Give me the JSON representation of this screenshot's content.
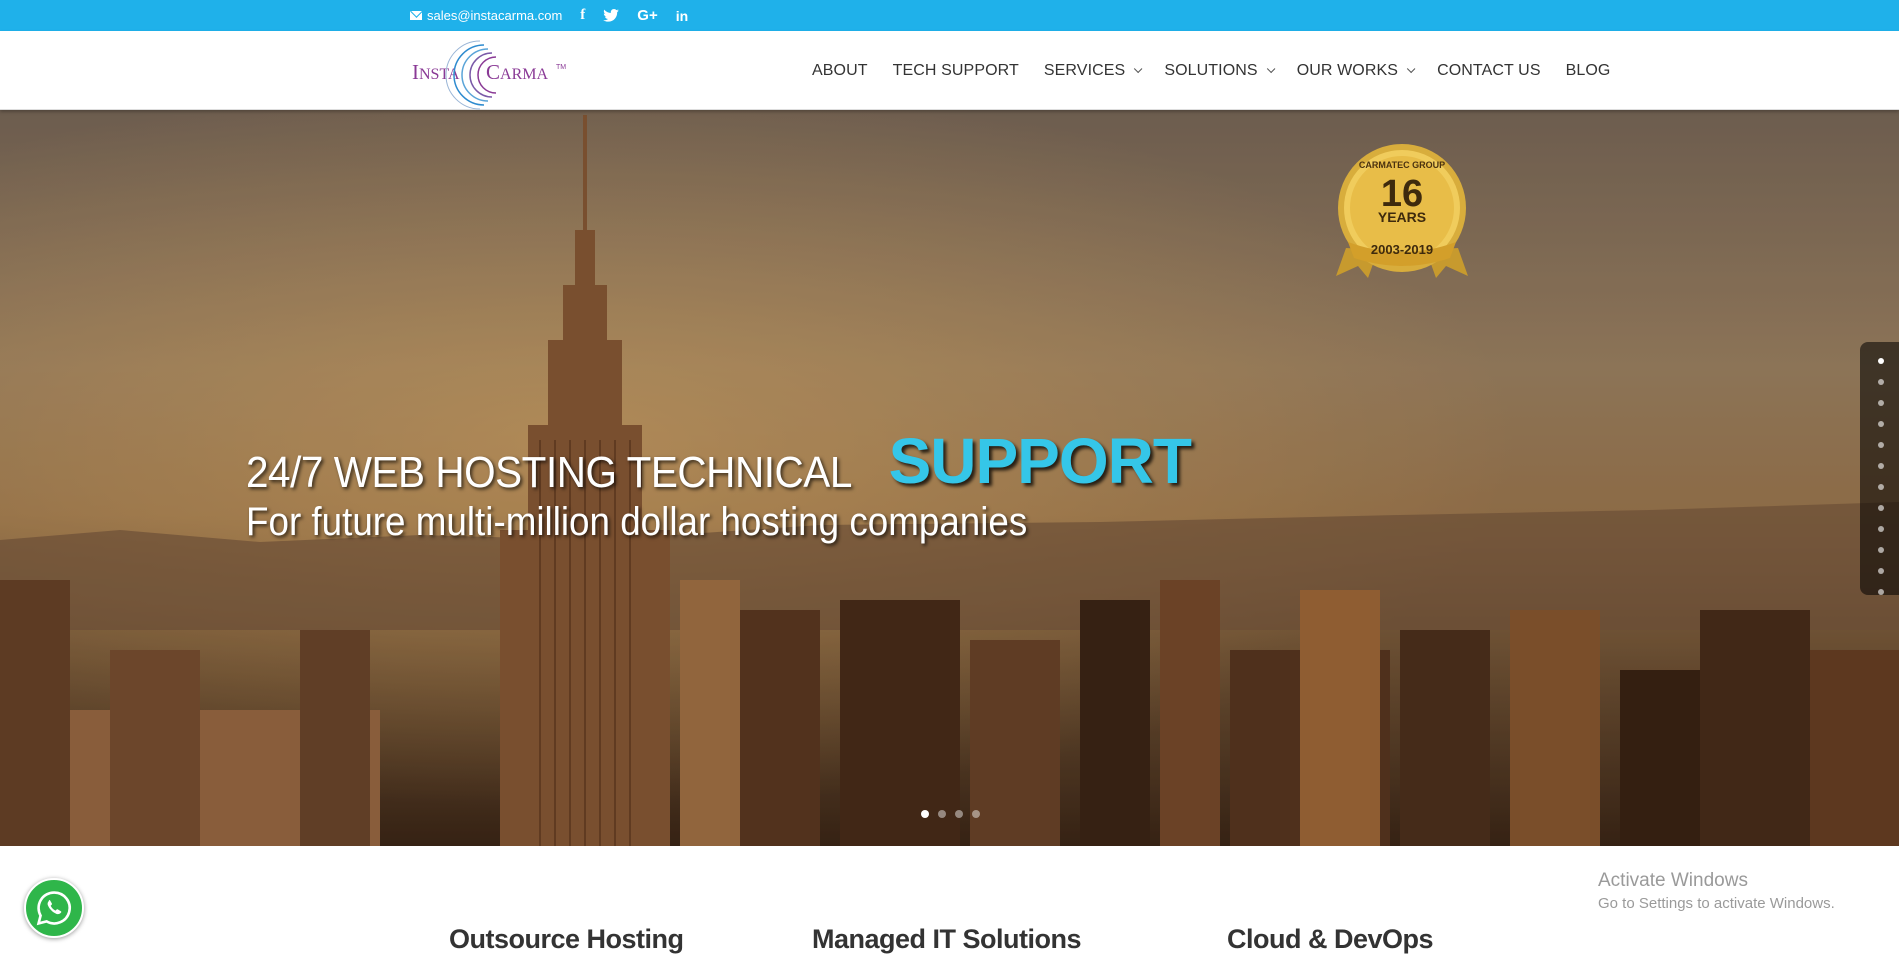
{
  "topbar": {
    "email": "sales@instacarma.com",
    "social": [
      "f",
      "🐦",
      "G+",
      "in"
    ],
    "social_names": [
      "facebook-icon",
      "twitter-icon",
      "google-plus-icon",
      "linkedin-icon"
    ],
    "color": "#1fb1ea"
  },
  "logo": {
    "left": "INSTA",
    "right": "CARMA",
    "tm": "™"
  },
  "nav": {
    "items": [
      {
        "label": "ABOUT"
      },
      {
        "label": "TECH SUPPORT"
      },
      {
        "label": "SERVICES"
      },
      {
        "label": "SOLUTIONS"
      },
      {
        "label": "OUR WORKS"
      },
      {
        "label": "CONTACT US"
      },
      {
        "label": "BLOG"
      }
    ]
  },
  "hero": {
    "line1": "24/7 WEB HOSTING TECHNICAL",
    "line1_highlight": "SUPPORT",
    "line2": "For future multi-million dollar hosting companies",
    "highlight_color": "#35c6e8"
  },
  "badge": {
    "group": "CARMATEC GROUP",
    "number": "16",
    "unit": "YEARS",
    "range": "2003-2019"
  },
  "side_nav": {
    "count": 12,
    "active_index": 0
  },
  "slider": {
    "count": 4,
    "active_index": 0
  },
  "services": {
    "titles": [
      "Outsource Hosting",
      "Managed IT Solutions",
      "Cloud & DevOps"
    ]
  },
  "windows_watermark": {
    "line1": "Activate Windows",
    "line2": "Go to Settings to activate Windows."
  },
  "whatsapp": {
    "icon": "whatsapp-icon",
    "color": "#2fb64a"
  }
}
